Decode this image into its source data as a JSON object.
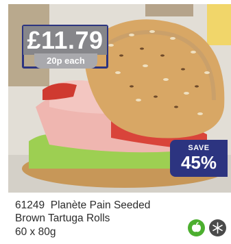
{
  "product": {
    "price": "£11.79",
    "unit_price": "20p each",
    "save_label": "SAVE",
    "save_value": "45%",
    "code": "61249",
    "name_line1": "Planète Pain Seeded",
    "name_line2": "Brown Tartuga Rolls",
    "weight": "60 x 80g"
  },
  "icons": {
    "vegetarian": "vegetarian-apple-icon",
    "frozen": "frozen-snowflake-icon"
  },
  "colors": {
    "brand_navy": "#2c3480",
    "price_grey": "#86868a",
    "vegetarian_green": "#4caf2f"
  }
}
